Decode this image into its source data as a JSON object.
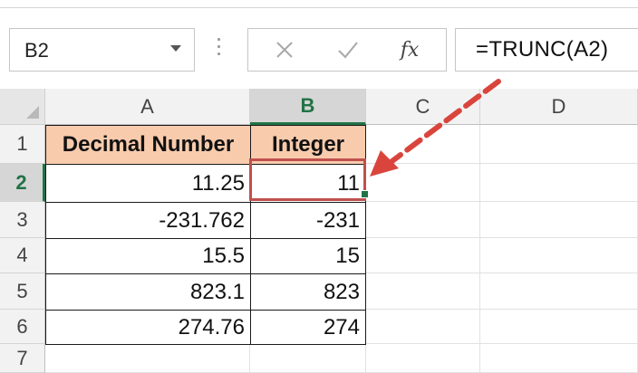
{
  "name_box": {
    "value": "B2"
  },
  "formula_bar": {
    "formula": "=TRUNC(A2)",
    "fx_label": "fx"
  },
  "columns": [
    "A",
    "B",
    "C",
    "D"
  ],
  "rows": [
    "1",
    "2",
    "3",
    "4",
    "5",
    "6",
    "7"
  ],
  "headers": {
    "A": "Decimal Number",
    "B": "Integer"
  },
  "data": [
    {
      "a": "11.25",
      "b": "11"
    },
    {
      "a": "-231.762",
      "b": "-231"
    },
    {
      "a": "15.5",
      "b": "15"
    },
    {
      "a": "823.1",
      "b": "823"
    },
    {
      "a": "274.76",
      "b": "274"
    }
  ],
  "selection": {
    "cell": "B2",
    "column": "B",
    "row": "2"
  },
  "colors": {
    "header_fill": "#f8cbad",
    "selection_border": "#c0504d",
    "arrow": "#d9453c",
    "excel_green": "#217346"
  }
}
